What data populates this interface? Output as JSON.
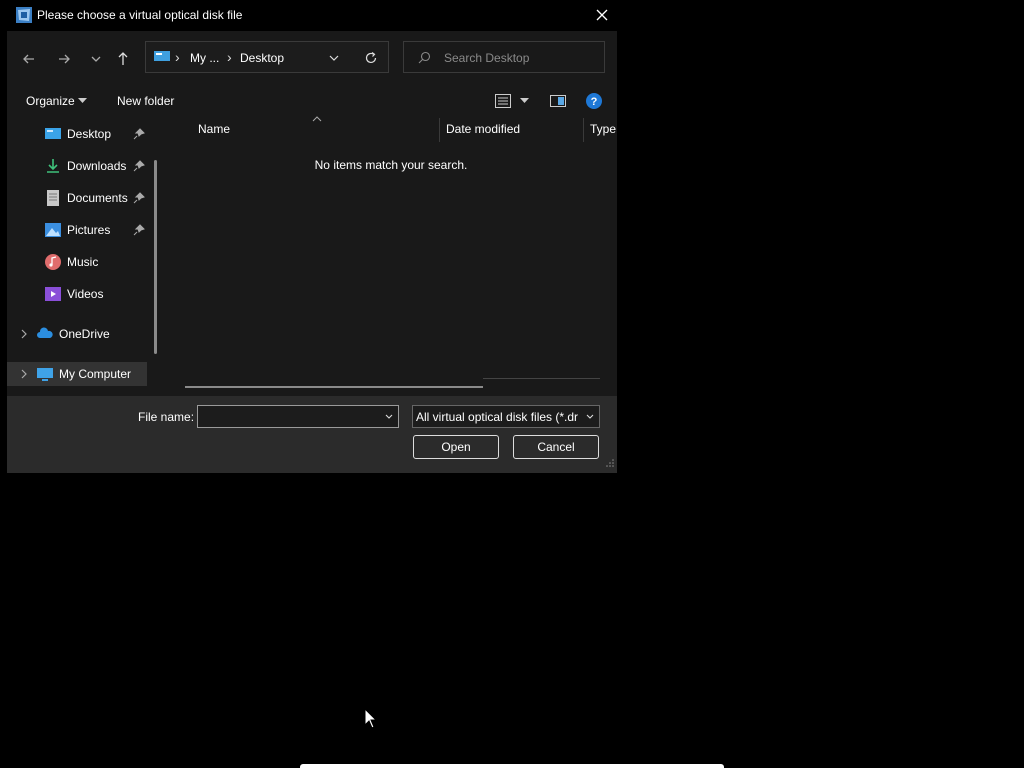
{
  "window": {
    "title": "Please choose a virtual optical disk file"
  },
  "address_bar": {
    "crumbs": [
      "My ...",
      "Desktop"
    ]
  },
  "search": {
    "placeholder": "Search Desktop"
  },
  "toolbar": {
    "organize_label": "Organize",
    "new_folder_label": "New folder"
  },
  "sidebar": {
    "items": [
      {
        "label": "Desktop",
        "icon": "desktop-icon",
        "pinned": true
      },
      {
        "label": "Downloads",
        "icon": "download-icon",
        "pinned": true
      },
      {
        "label": "Documents",
        "icon": "documents-icon",
        "pinned": true
      },
      {
        "label": "Pictures",
        "icon": "pictures-icon",
        "pinned": true
      },
      {
        "label": "Music",
        "icon": "music-icon",
        "pinned": false
      },
      {
        "label": "Videos",
        "icon": "videos-icon",
        "pinned": false
      },
      {
        "label": "OneDrive",
        "icon": "cloud-icon",
        "pinned": false
      },
      {
        "label": "My Computer",
        "icon": "computer-icon",
        "pinned": false
      }
    ]
  },
  "file_list": {
    "columns": [
      "Name",
      "Date modified",
      "Type"
    ],
    "empty_message": "No items match your search."
  },
  "footer": {
    "file_name_label": "File name:",
    "file_name_value": "",
    "filter_value": "All virtual optical disk files (*.dr",
    "open_label": "Open",
    "cancel_label": "Cancel"
  },
  "colors": {
    "accent": "#0078d4",
    "background": "#191919",
    "footer_background": "#2b2b2b"
  }
}
